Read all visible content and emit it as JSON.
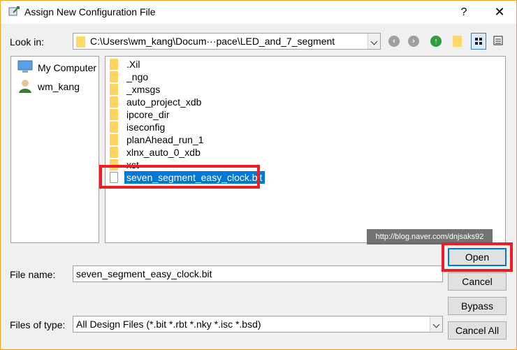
{
  "window": {
    "title": "Assign New Configuration File",
    "help_label": "?",
    "close_label": "✕"
  },
  "look_in": {
    "label": "Look in:",
    "path": "C:\\Users\\wm_kang\\Docum···pace\\LED_and_7_segment"
  },
  "places": [
    {
      "label": "My Computer",
      "icon": "computer-icon"
    },
    {
      "label": "wm_kang",
      "icon": "user-icon"
    }
  ],
  "files": [
    {
      "name": ".Xil",
      "type": "folder"
    },
    {
      "name": "_ngo",
      "type": "folder"
    },
    {
      "name": "_xmsgs",
      "type": "folder"
    },
    {
      "name": "auto_project_xdb",
      "type": "folder"
    },
    {
      "name": "ipcore_dir",
      "type": "folder"
    },
    {
      "name": "iseconfig",
      "type": "folder"
    },
    {
      "name": "planAhead_run_1",
      "type": "folder"
    },
    {
      "name": "xlnx_auto_0_xdb",
      "type": "folder"
    },
    {
      "name": "xst",
      "type": "folder"
    },
    {
      "name": "seven_segment_easy_clock.bit",
      "type": "file",
      "selected": true
    }
  ],
  "watermark": "http://blog.naver.com/dnjsaks92",
  "file_name": {
    "label": "File name:",
    "value": "seven_segment_easy_clock.bit"
  },
  "files_of_type": {
    "label": "Files of type:",
    "value": "All Design Files (*.bit *.rbt *.nky *.isc *.bsd)"
  },
  "buttons": {
    "open": "Open",
    "cancel": "Cancel",
    "bypass": "Bypass",
    "cancel_all": "Cancel All"
  },
  "colors": {
    "highlight": "#ee1c25",
    "selection": "#0078d7",
    "window_border": "#f7a21a"
  }
}
